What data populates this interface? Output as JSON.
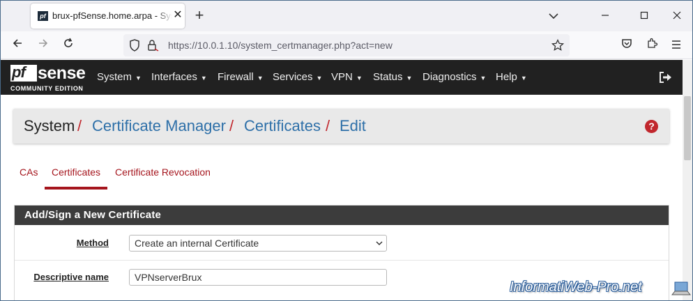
{
  "browser": {
    "tab_title": "brux-pfSense.home.arpa - System: Certificate Manager",
    "favicon_text": "pf",
    "url_host": "https://10.0.1.10",
    "url_path": "/system_certmanager.php?act=new",
    "icons": [
      "back-icon",
      "forward-icon",
      "reload-icon",
      "shield-icon",
      "lock-icon",
      "star-icon",
      "pocket-icon",
      "extensions-icon",
      "menu-icon"
    ]
  },
  "pfsense": {
    "logo_pf": "pf",
    "logo_sense": "sense",
    "logo_edition": "COMMUNITY EDITION",
    "menu": [
      "System",
      "Interfaces",
      "Firewall",
      "Services",
      "VPN",
      "Status",
      "Diagnostics",
      "Help"
    ]
  },
  "breadcrumb": {
    "root": "System",
    "item1": "Certificate Manager",
    "item2": "Certificates",
    "item3": "Edit",
    "separator": "/"
  },
  "tabs": [
    "CAs",
    "Certificates",
    "Certificate Revocation"
  ],
  "active_tab": "Certificates",
  "panel": {
    "title": "Add/Sign a New Certificate",
    "method_label": "Method",
    "method_value": "Create an internal Certificate",
    "descr_label": "Descriptive name",
    "descr_value": "VPNserverBrux"
  },
  "watermark": "InformatiWeb-Pro.net",
  "colors": {
    "accent_red": "#c1272d",
    "link_blue": "#2d6fa8",
    "header_bg": "#212121",
    "panel_head": "#3c3c3c"
  }
}
